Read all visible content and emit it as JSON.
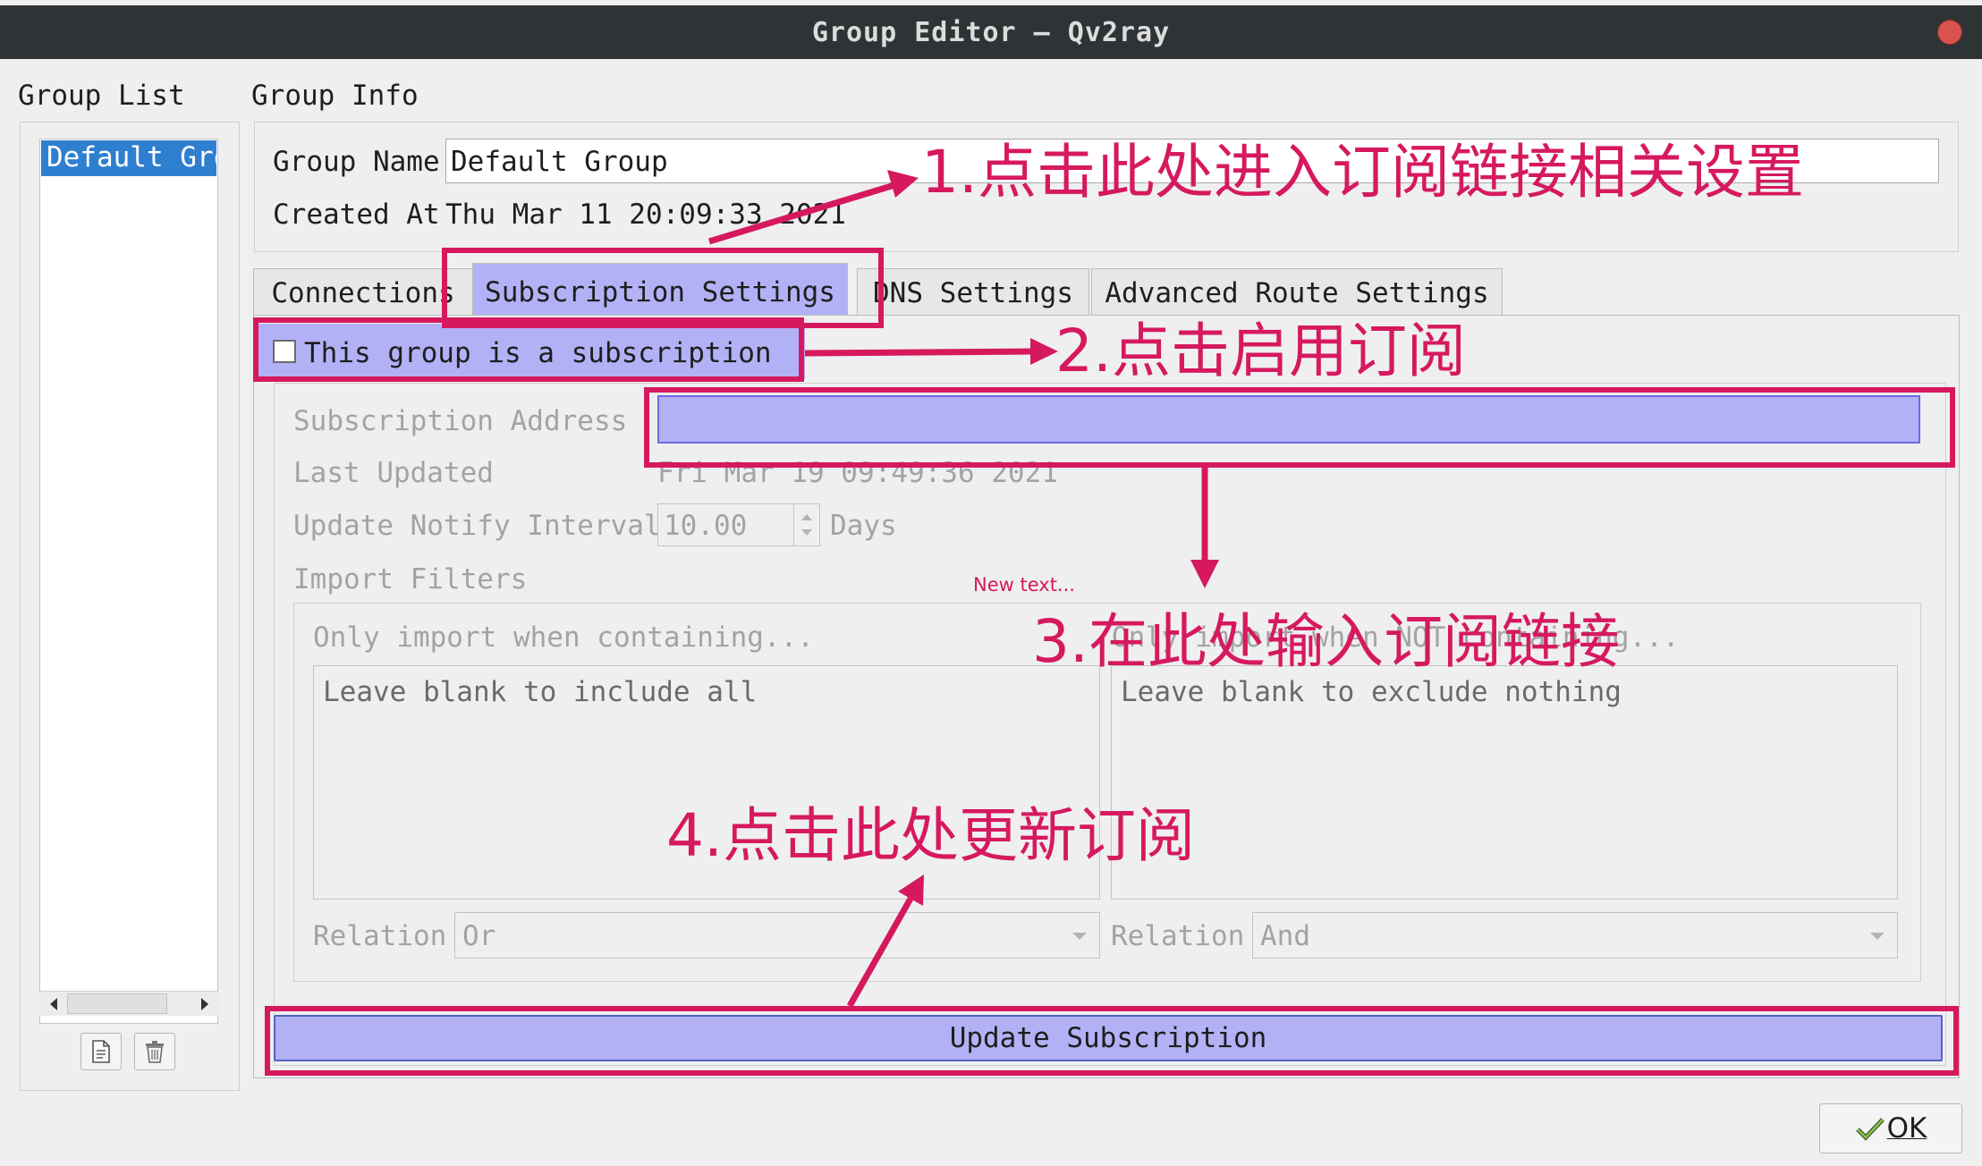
{
  "window": {
    "title": "Group Editor — Qv2ray"
  },
  "group_list": {
    "label": "Group List",
    "items": [
      {
        "label": "Default Group"
      }
    ],
    "add_icon": "new-document-icon",
    "delete_icon": "trash-icon"
  },
  "group_info": {
    "label": "Group Info",
    "name_label": "Group Name",
    "name_value": "Default Group",
    "created_label": "Created At",
    "created_value": "Thu Mar 11 20:09:33 2021"
  },
  "tabs": [
    {
      "label": "Connections"
    },
    {
      "label": "Subscription Settings"
    },
    {
      "label": "DNS Settings"
    },
    {
      "label": "Advanced Route Settings"
    }
  ],
  "subscription": {
    "checkbox_label": "This group is a subscription",
    "address_label": "Subscription Address",
    "address_value": "",
    "last_updated_label": "Last Updated",
    "last_updated_value": "Fri Mar 19 09:49:36 2021",
    "interval_label": "Update Notify Interval",
    "interval_value": "10.00",
    "interval_unit": "Days",
    "import_filters_label": "Import Filters",
    "new_text_label": "New text...",
    "include_header": "Only import when containing...",
    "exclude_header": "Only import when NOT containing...",
    "include_placeholder": "Leave blank to include all",
    "exclude_placeholder": "Leave blank to exclude nothing",
    "relation_label": "Relation",
    "include_relation": "Or",
    "exclude_relation": "And",
    "update_button": "Update Subscription"
  },
  "ok_button": "OK",
  "annotations": {
    "step1": "1.点击此处进入订阅链接相关设置",
    "step2": "2.点击启用订阅",
    "step3": "3.在此处输入订阅链接",
    "step4": "4.点击此处更新订阅"
  },
  "colors": {
    "annotation": "#d6195f",
    "highlight_fill": "#b3b1f6",
    "selection": "#2f7fd1",
    "titlebar": "#2e3436"
  }
}
